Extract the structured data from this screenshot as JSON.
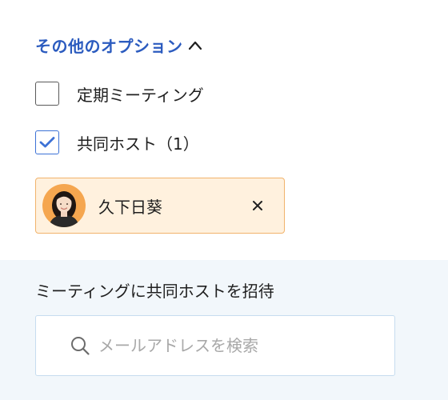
{
  "options": {
    "toggle_label": "その他のオプション",
    "expanded": true
  },
  "recurring": {
    "label": "定期ミーティング",
    "checked": false
  },
  "cohost": {
    "label": "共同ホスト（1）",
    "checked": true
  },
  "cohost_chip": {
    "name": "久下日葵",
    "remove_icon": "close-icon"
  },
  "invite": {
    "title": "ミーティングに共同ホストを招待",
    "search_placeholder": "メールアドレスを検索",
    "search_value": ""
  },
  "colors": {
    "link_blue": "#2b5bbf",
    "checkbox_blue": "#3d72d6",
    "chip_bg": "#fff1de",
    "chip_border": "#f1b36c",
    "panel_bg": "#f2f7fb",
    "search_border": "#c6dcef"
  }
}
